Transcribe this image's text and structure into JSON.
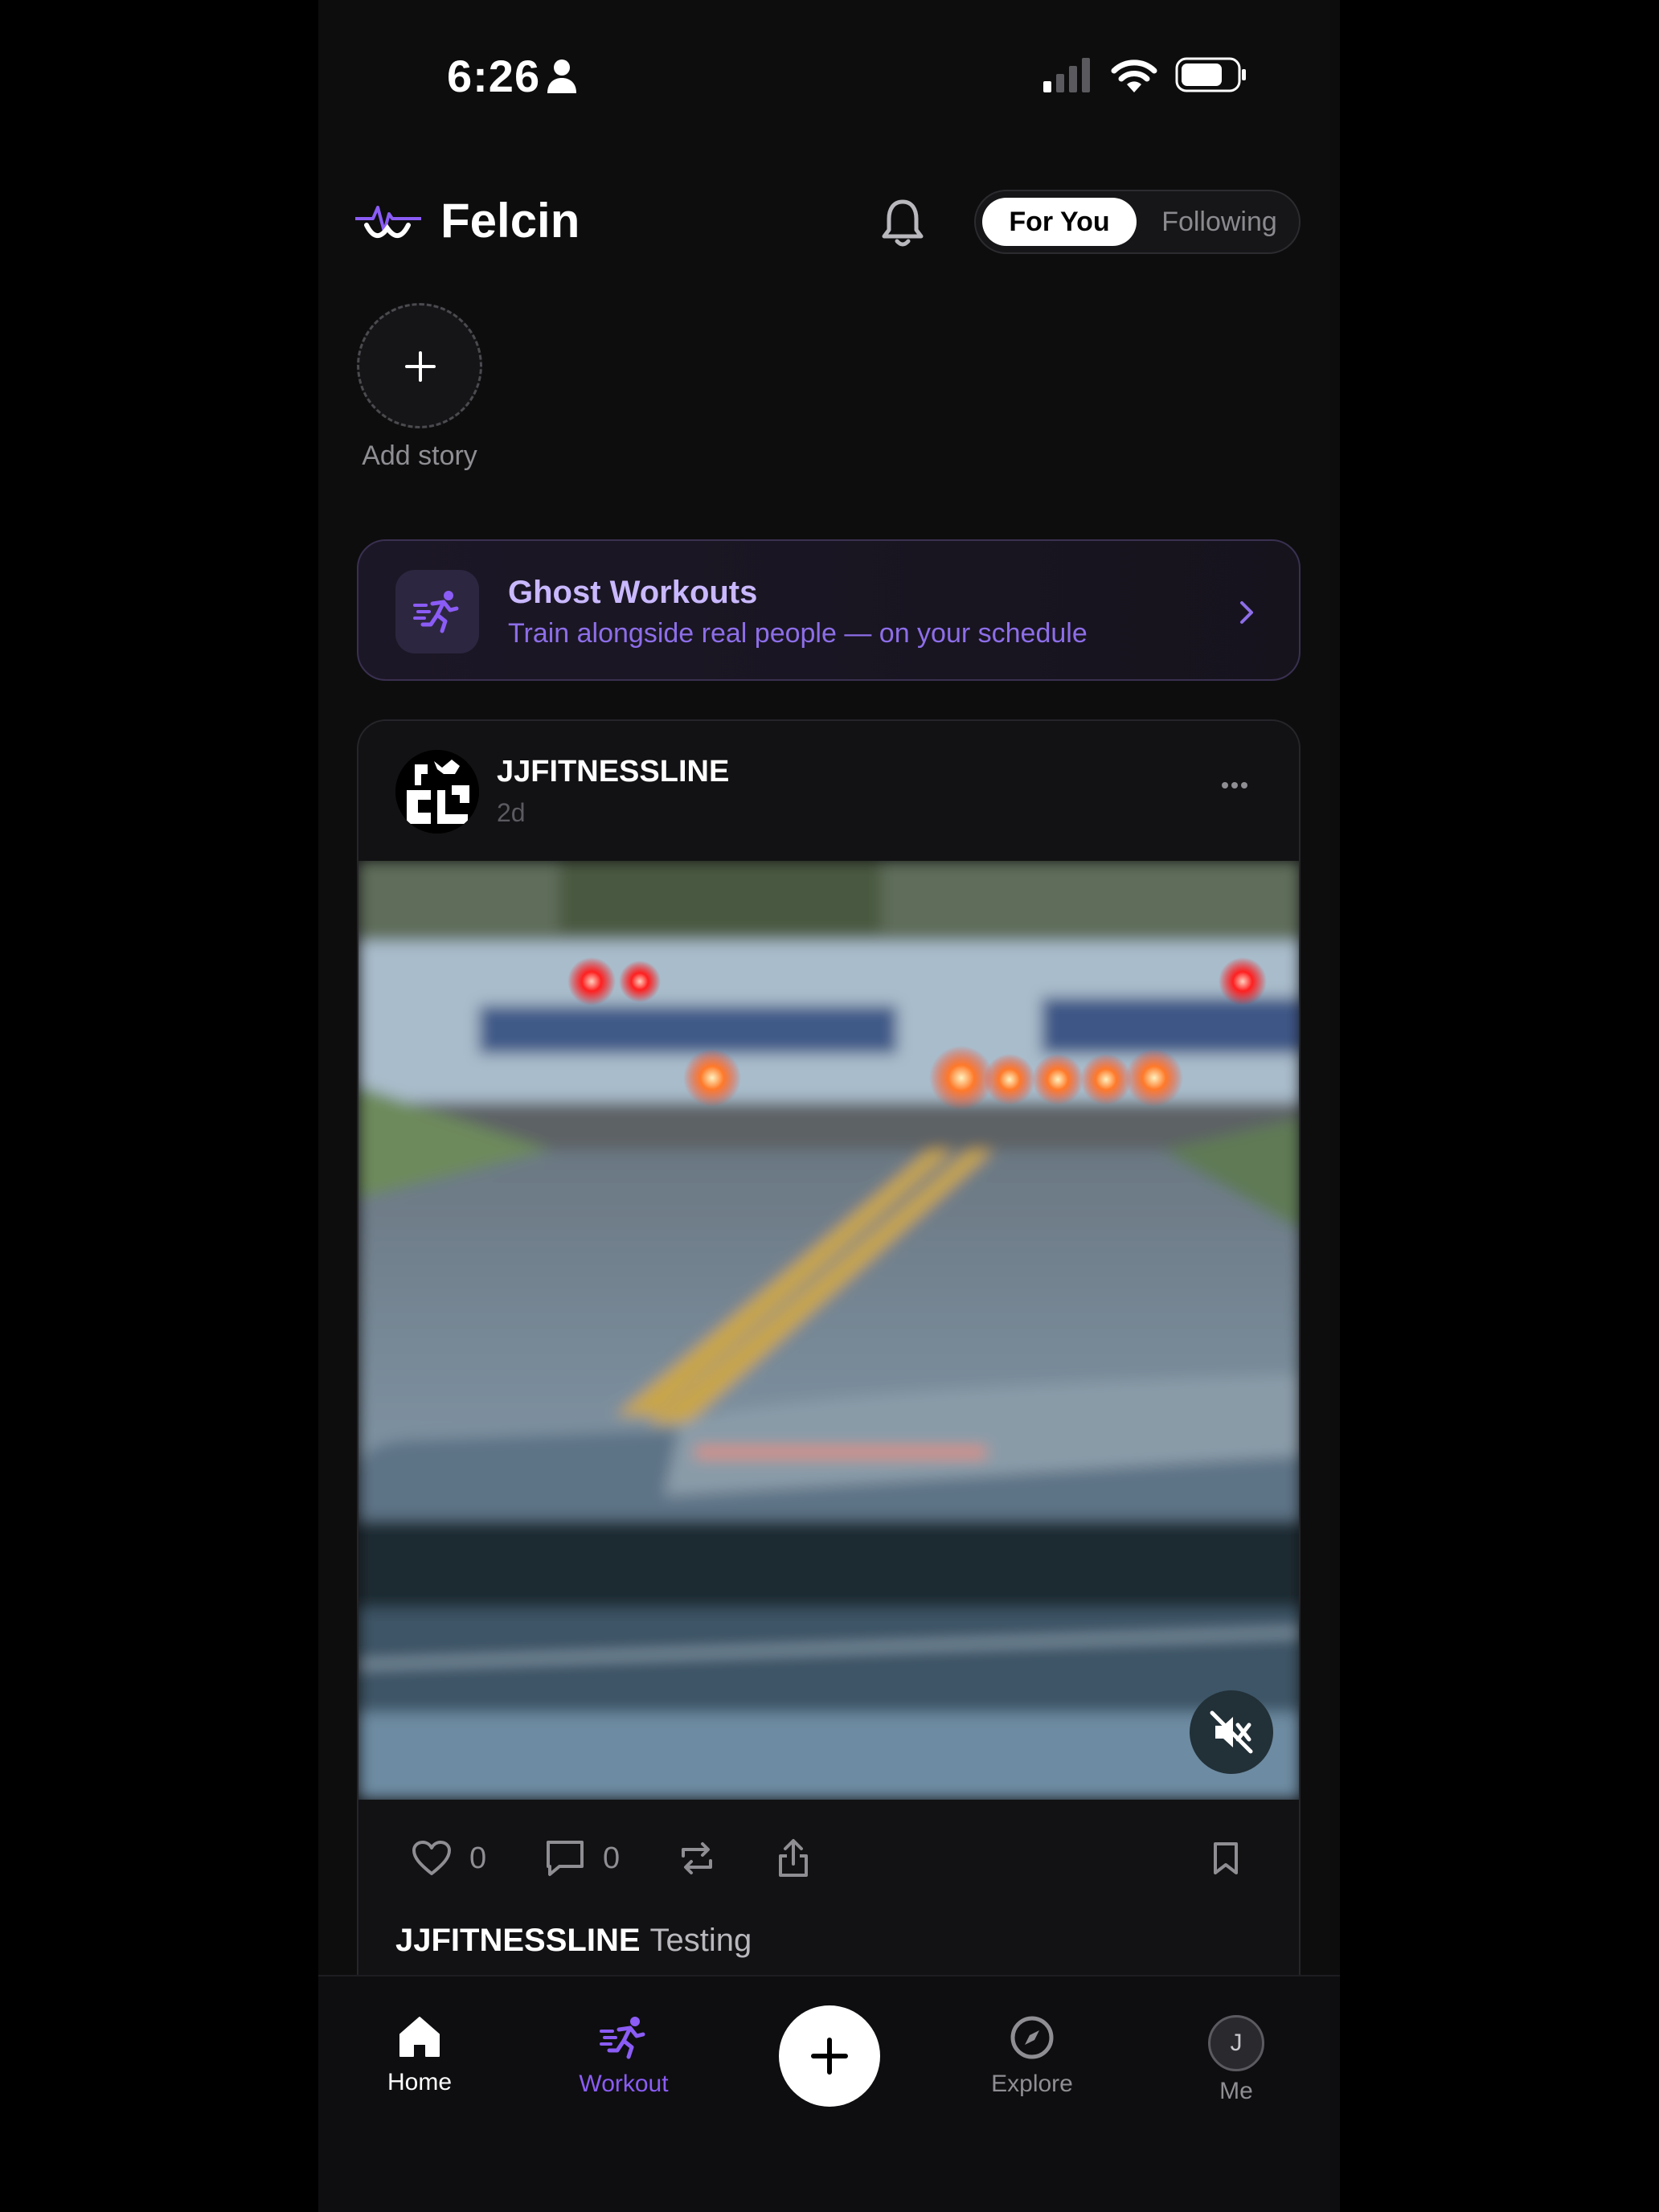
{
  "status_bar": {
    "time": "6:26"
  },
  "header": {
    "app_name": "Felcin",
    "feed_toggle": {
      "active": "For You",
      "inactive": "Following"
    }
  },
  "stories": {
    "add_label": "Add story"
  },
  "ghost_banner": {
    "title": "Ghost Workouts",
    "subtitle": "Train alongside real people — on your schedule"
  },
  "post": {
    "username": "JJFITNESSLINE",
    "time_ago": "2d",
    "likes": "0",
    "comments": "0",
    "caption_user": "JJFITNESSLINE",
    "caption_text": "Testing"
  },
  "tab_bar": {
    "home": "Home",
    "workout": "Workout",
    "explore": "Explore",
    "me": "Me",
    "me_initial": "J"
  },
  "colors": {
    "accent": "#8b5cf6",
    "background": "#0d0d0e",
    "banner_title": "#c9b8ff"
  }
}
